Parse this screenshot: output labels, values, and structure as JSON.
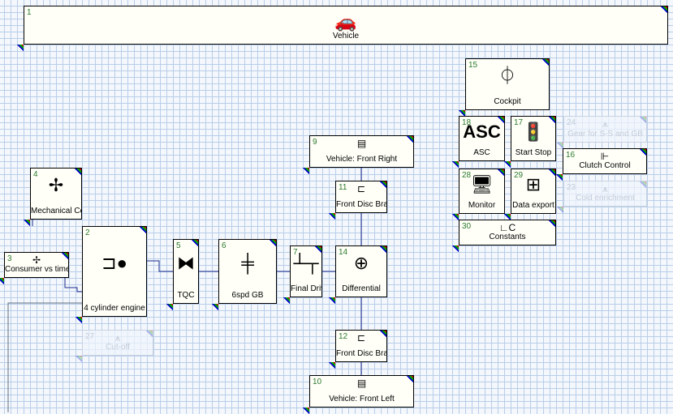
{
  "blocks": [
    {
      "id": "1",
      "label": "Vehicle",
      "icon": "car-icon",
      "glyph": "🚗"
    },
    {
      "id": "15",
      "label": "Cockpit",
      "icon": "cockpit-icon",
      "glyph": "⏀"
    },
    {
      "id": "18",
      "label": "ASC",
      "icon": "asc-icon",
      "glyph": "ASC"
    },
    {
      "id": "17",
      "label": "Start Stop",
      "icon": "traffic-light-icon",
      "glyph": "🚦"
    },
    {
      "id": "24",
      "label": "Gear for S-S and GB",
      "icon": "function-icon",
      "glyph": "⩚",
      "faded": true
    },
    {
      "id": "16",
      "label": "Clutch Control",
      "icon": "clutch-icon",
      "glyph": "⊩"
    },
    {
      "id": "28",
      "label": "Monitor",
      "icon": "monitor-icon",
      "glyph": "🖥"
    },
    {
      "id": "29",
      "label": "Data export",
      "icon": "data-export-icon",
      "glyph": "⊞"
    },
    {
      "id": "23",
      "label": "Cold enrichment",
      "icon": "function-icon",
      "glyph": "⩚",
      "faded": true
    },
    {
      "id": "30",
      "label": "Constants",
      "icon": "constants-icon",
      "glyph": "∟C"
    },
    {
      "id": "9",
      "label": "Vehicle: Front Right",
      "icon": "wheel-icon",
      "glyph": "▤"
    },
    {
      "id": "11",
      "label": "Front Disc Brake",
      "icon": "disc-brake-icon",
      "glyph": "⊏"
    },
    {
      "id": "4",
      "label": "Mechanical Con",
      "icon": "fan-icon",
      "glyph": "✢"
    },
    {
      "id": "3",
      "label": "Consumer vs time",
      "icon": "fan-icon",
      "glyph": "✢"
    },
    {
      "id": "2",
      "label": "4 cylinder engine",
      "icon": "engine-icon",
      "glyph": "⊐●"
    },
    {
      "id": "27",
      "label": "Cut-off",
      "icon": "function-icon",
      "glyph": "⩚",
      "faded": true
    },
    {
      "id": "5",
      "label": "TQC",
      "icon": "torque-converter-icon",
      "glyph": "⧓"
    },
    {
      "id": "6",
      "label": "6spd GB",
      "icon": "gearbox-icon",
      "glyph": "╪"
    },
    {
      "id": "7",
      "label": "Final Driv",
      "icon": "final-drive-icon",
      "glyph": "┴┬"
    },
    {
      "id": "14",
      "label": "Differential",
      "icon": "differential-icon",
      "glyph": "⊕"
    },
    {
      "id": "12",
      "label": "Front Disc Brake",
      "icon": "disc-brake-icon",
      "glyph": "⊏"
    },
    {
      "id": "10",
      "label": "Vehicle: Front Left",
      "icon": "wheel-icon",
      "glyph": "▤"
    }
  ]
}
